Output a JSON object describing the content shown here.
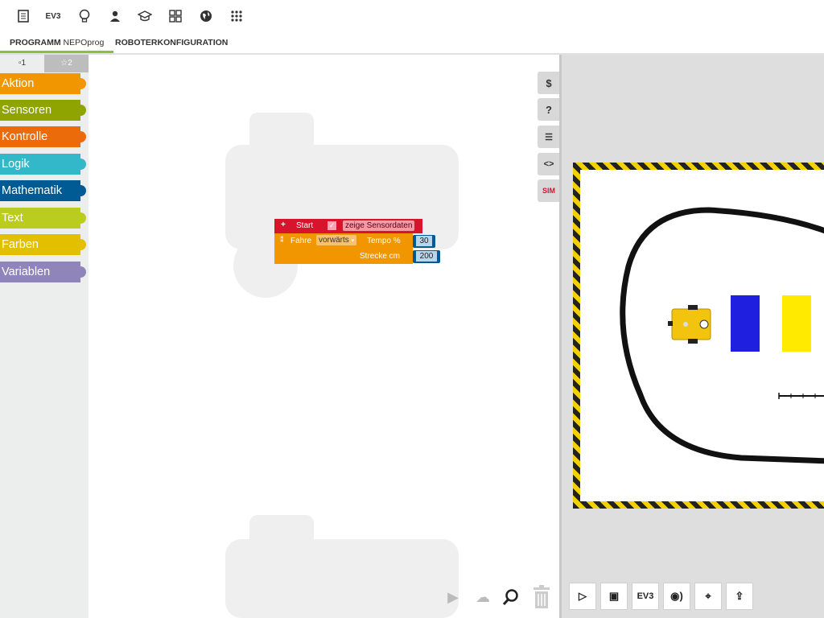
{
  "topbar": {
    "icons": [
      "document-icon",
      "ev3-icon",
      "lightbulb-icon",
      "user-icon",
      "graduation-cap-icon",
      "gallery-grid-icon",
      "globe-icon",
      "apps-dots-icon"
    ],
    "ev3_label": "EV3"
  },
  "tabs": {
    "program_label": "PROGRAMM",
    "program_name": "NEPOprog",
    "config_label": "ROBOTERKONFIGURATION"
  },
  "toolbox": {
    "tab1": "▫1",
    "tab2": "☆2",
    "categories": [
      {
        "label": "Aktion",
        "color": "#f29600"
      },
      {
        "label": "Sensoren",
        "color": "#8fa400"
      },
      {
        "label": "Kontrolle",
        "color": "#eb6a0a"
      },
      {
        "label": "Logik",
        "color": "#33b8ca"
      },
      {
        "label": "Mathematik",
        "color": "#005a94"
      },
      {
        "label": "Text",
        "color": "#bacc1e"
      },
      {
        "label": "Farben",
        "color": "#e2c000"
      },
      {
        "label": "Variablen",
        "color": "#9085ba"
      }
    ]
  },
  "blocks": {
    "start": {
      "plus": "+",
      "label": "Start",
      "checkbox": "✓",
      "sensor_label": "zeige Sensordaten",
      "color": "#d7142b"
    },
    "drive": {
      "label": "Fahre",
      "direction": "vorwärts",
      "direction_arrow": "▾",
      "speed_label": "Tempo %",
      "speed_value": "30",
      "distance_label": "Strecke cm",
      "distance_value": "200",
      "color": "#f29600"
    }
  },
  "side_buttons": [
    "$",
    "?",
    "☰",
    "<>",
    "SIM"
  ],
  "sim_buttons": {
    "play": "▷",
    "image": "▣",
    "ev3": "EV3",
    "sound": "◉)",
    "pin": "⌖",
    "export": "⇪"
  },
  "workspace_buttons": {
    "run": "▶",
    "upload": "☁",
    "zoom": "🔍",
    "trash": "🗑"
  },
  "colors": {
    "accent": "#8fbf3a",
    "sim_blue": "#1f1fe0",
    "sim_yellow": "#ffea00",
    "robot_yellow": "#f2c30f"
  }
}
